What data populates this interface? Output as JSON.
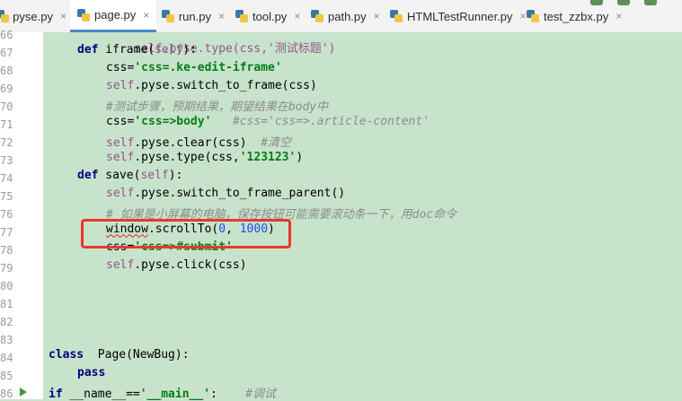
{
  "tabs": [
    {
      "label": "pyse.py",
      "active": false
    },
    {
      "label": "page.py",
      "active": true
    },
    {
      "label": "run.py",
      "active": false
    },
    {
      "label": "tool.py",
      "active": false
    },
    {
      "label": "path.py",
      "active": false
    },
    {
      "label": "HTMLTestRunner.py",
      "active": false
    },
    {
      "label": "test_zzbx.py",
      "active": false
    }
  ],
  "close_glyph": "×",
  "line_numbers": [
    "66",
    "67",
    "68",
    "69",
    "70",
    "71",
    "72",
    "73",
    "74",
    "75",
    "76",
    "77",
    "78",
    "79",
    "80",
    "81",
    "82",
    "83",
    "84",
    "85",
    "86"
  ],
  "code": {
    "l66_a": "self.pyse.type(css,'测试标题')",
    "l67_def": "def",
    "l67_name": " iframe(",
    "l67_self": "self",
    "l67_end": "):",
    "l68_a": "css=",
    "l68_str": "'css=.ke-edit-iframe'",
    "l69_self": "self",
    "l69_rest": ".pyse.switch_to_frame(css)",
    "l70_cmt": "#测试步骤，预期结果，期望结果在body中",
    "l71_a": "css=",
    "l71_str": "'css=>body'",
    "l71_cmt": "   #css='css=>.article-content'",
    "l72_self": "self",
    "l72_rest": ".pyse.clear(css)  ",
    "l72_cmt": "#清空",
    "l73_self": "self",
    "l73_rest": ".pyse.type(css,",
    "l73_str": "'123123'",
    "l73_end": ")",
    "l74_def": "def",
    "l74_name": " save(",
    "l74_self": "self",
    "l74_end": "):",
    "l75_self": "self",
    "l75_rest": ".pyse.switch_to_frame_parent()",
    "l76_cmt": "# 如果是小屏幕的电脑，保存按钮可能需要滚动条一下，用doc命令",
    "l77_a": "window",
    ".l77_b": "",
    "l77_rest": ".scrollTo(",
    "l77_n1": "0",
    "l77_mid": ", ",
    "l77_n2": "1000",
    "l77_end": ")",
    "l78_a": "css=",
    "l78_str": "'css=>#submit'",
    "l79_self": "self",
    "l79_rest": ".pyse.click(css)",
    "l84_kw": "class",
    "l84_rest": "  Page(NewBug):",
    "l85_kw": "pass",
    "l86_kw": "if",
    "l86_a": " __name__==",
    "l86_str": "'__main__'",
    "l86_b": ":    ",
    "l86_cmt": "#调试"
  }
}
